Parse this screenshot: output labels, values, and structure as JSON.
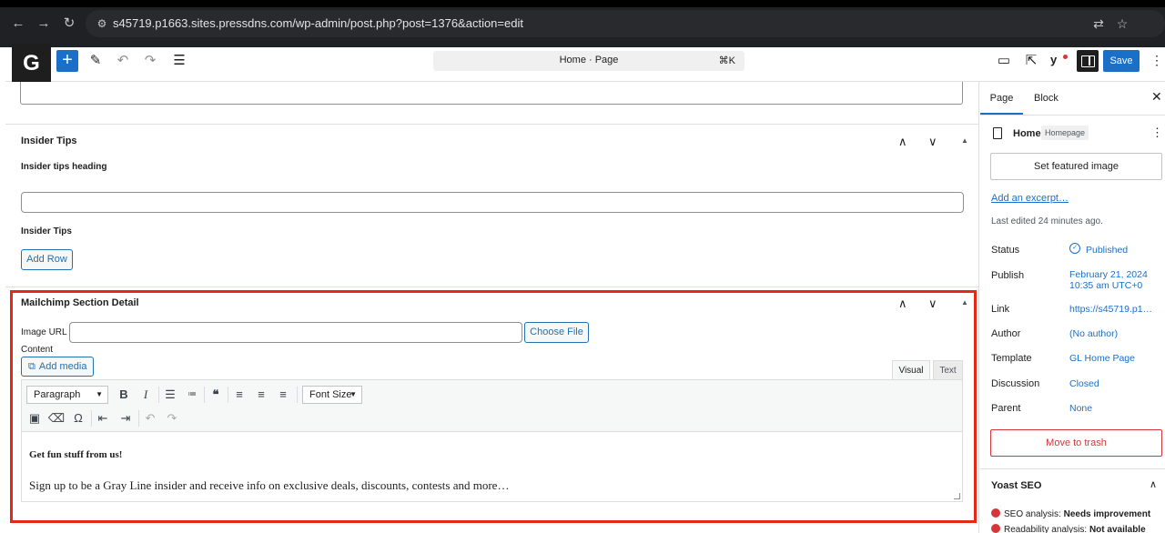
{
  "browser": {
    "url": "s45719.p1663.sites.pressdns.com/wp-admin/post.php?post=1376&action=edit",
    "icons": [
      "back-icon",
      "forward-icon",
      "reload-icon",
      "site-settings-icon",
      "translate-icon",
      "bookmark-star-icon"
    ]
  },
  "header": {
    "logo_letter": "G",
    "inserter_label": "+",
    "document_title": "Home · Page",
    "shortcut": "⌘K",
    "save_label": "Save",
    "yoast_letter": "y",
    "colors": {
      "accent": "#1a6fc9",
      "dark": "#1e1e1e"
    }
  },
  "main": {
    "insider_tips": {
      "title": "Insider Tips",
      "heading_label": "Insider tips heading",
      "heading_value": "",
      "tips_label": "Insider Tips",
      "add_row_label": "Add Row"
    },
    "mailchimp": {
      "title": "Mailchimp Section Detail",
      "image_url_label": "Image URL",
      "image_url_value": "",
      "choose_file_label": "Choose File",
      "content_label": "Content",
      "add_media_label": "Add media",
      "tabs": {
        "visual": "Visual",
        "text": "Text"
      },
      "format_select": "Paragraph",
      "font_size_select": "Font Size",
      "content_heading": "Get fun stuff from us!",
      "content_paragraph": "Sign up to be a Gray Line insider and receive info on exclusive deals, discounts, contests and more…",
      "highlight_color": "#e6281b"
    }
  },
  "sidebar": {
    "tabs": {
      "page": "Page",
      "block": "Block"
    },
    "page_title": "Home",
    "page_badge": "Homepage",
    "featured_image_label": "Set featured image",
    "excerpt_link": "Add an excerpt…",
    "last_edited": "Last edited 24 minutes ago.",
    "rows": {
      "status_label": "Status",
      "status_value": "Published",
      "publish_label": "Publish",
      "publish_date": "February 21, 2024",
      "publish_time": "10:35 am UTC+0",
      "link_label": "Link",
      "link_value": "https://s45719.p1…",
      "author_label": "Author",
      "author_value": "(No author)",
      "template_label": "Template",
      "template_value": "GL Home Page",
      "discussion_label": "Discussion",
      "discussion_value": "Closed",
      "parent_label": "Parent",
      "parent_value": "None"
    },
    "trash_label": "Move to trash",
    "yoast": {
      "title": "Yoast SEO",
      "seo_prefix": "SEO analysis:",
      "seo_value": "Needs improvement",
      "read_prefix": "Readability analysis:",
      "read_value": "Not available"
    }
  }
}
